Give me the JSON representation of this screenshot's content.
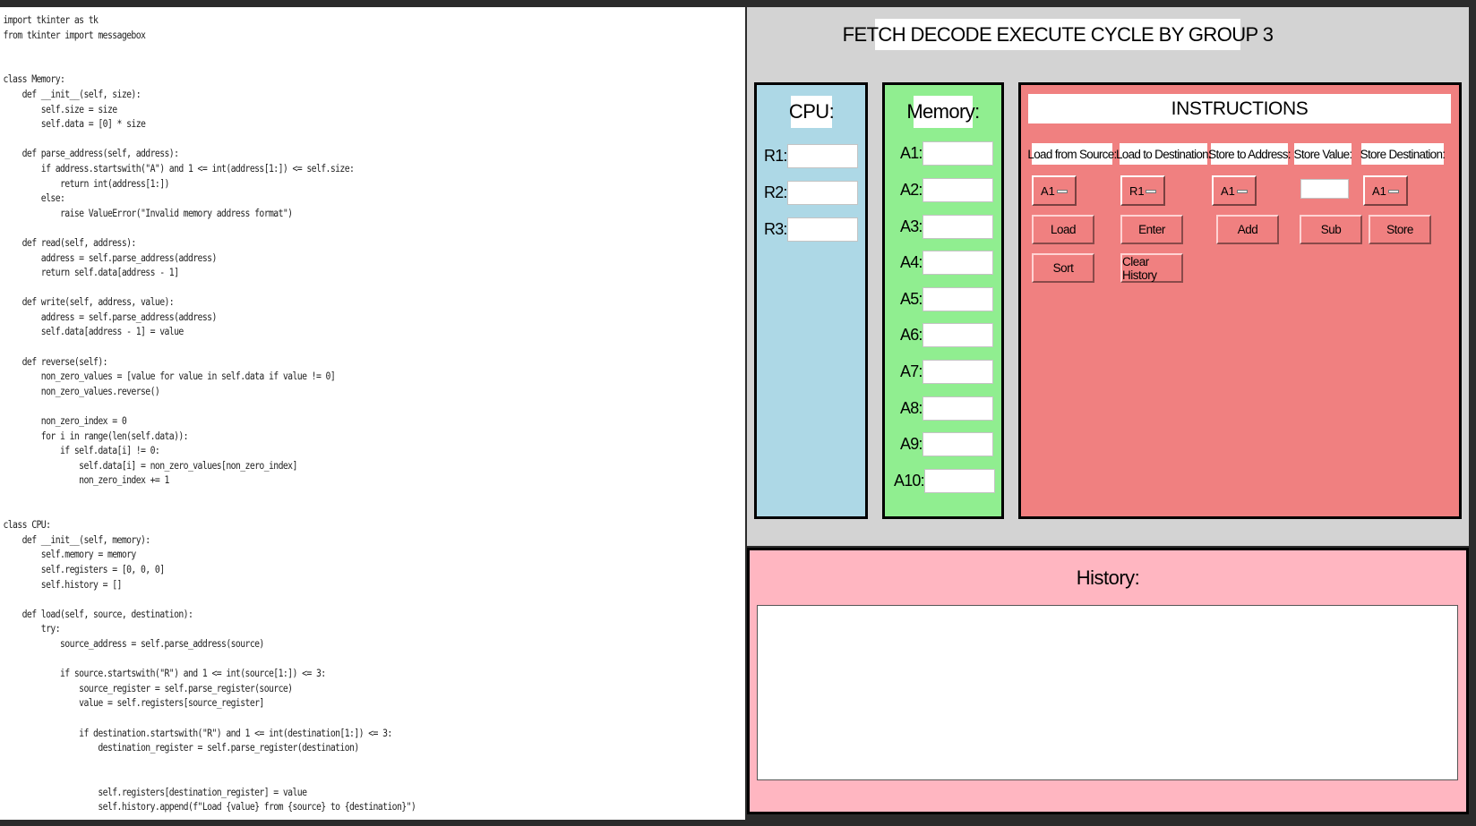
{
  "code": {
    "lines": [
      "import tkinter as tk",
      "from tkinter import messagebox",
      "",
      "",
      "class Memory:",
      "    def __init__(self, size):",
      "        self.size = size",
      "        self.data = [0] * size",
      "",
      "    def parse_address(self, address):",
      "        if address.startswith(\"A\") and 1 <= int(address[1:]) <= self.size:",
      "            return int(address[1:])",
      "        else:",
      "            raise ValueError(\"Invalid memory address format\")",
      "",
      "    def read(self, address):",
      "        address = self.parse_address(address)",
      "        return self.data[address - 1]",
      "",
      "    def write(self, address, value):",
      "        address = self.parse_address(address)",
      "        self.data[address - 1] = value",
      "",
      "    def reverse(self):",
      "        non_zero_values = [value for value in self.data if value != 0]",
      "        non_zero_values.reverse()",
      "",
      "        non_zero_index = 0",
      "        for i in range(len(self.data)):",
      "            if self.data[i] != 0:",
      "                self.data[i] = non_zero_values[non_zero_index]",
      "                non_zero_index += 1",
      "",
      "",
      "class CPU:",
      "    def __init__(self, memory):",
      "        self.memory = memory",
      "        self.registers = [0, 0, 0]",
      "        self.history = []",
      "",
      "    def load(self, source, destination):",
      "        try:",
      "            source_address = self.parse_address(source)",
      "",
      "            if source.startswith(\"R\") and 1 <= int(source[1:]) <= 3:",
      "                source_register = self.parse_register(source)",
      "                value = self.registers[source_register]",
      "",
      "                if destination.startswith(\"R\") and 1 <= int(destination[1:]) <= 3:",
      "                    destination_register = self.parse_register(destination)",
      "",
      "",
      "                    self.registers[destination_register] = value",
      "                    self.history.append(f\"Load {value} from {source} to {destination}\")"
    ]
  },
  "app": {
    "title": "FETCH DECODE EXECUTE CYCLE BY GROUP 3",
    "cpu": {
      "heading": "CPU:",
      "registers": [
        "R1:",
        "R2:",
        "R3:"
      ]
    },
    "memory": {
      "heading": "Memory:",
      "cells": [
        "A1:",
        "A2:",
        "A3:",
        "A4:",
        "A5:",
        "A6:",
        "A7:",
        "A8:",
        "A9:",
        "A10:"
      ]
    },
    "instructions": {
      "heading": "INSTRUCTIONS",
      "labels": [
        "Load from Source:",
        "Load to Destination:",
        "Store to Address:",
        "Store Value:",
        "Store Destination:"
      ],
      "selects": [
        "A1",
        "R1",
        "A1",
        "A1"
      ],
      "buttons": [
        "Load",
        "Enter",
        "Add",
        "Sub",
        "Store",
        "Sort",
        "Clear History"
      ]
    },
    "history": {
      "heading": "History:"
    }
  },
  "colors": {
    "window_bg": "#d3d3d3",
    "cpu_bg": "#add8e6",
    "memory_bg": "#90ee90",
    "instructions_bg": "#f08080",
    "history_bg": "#ffb6c1"
  }
}
